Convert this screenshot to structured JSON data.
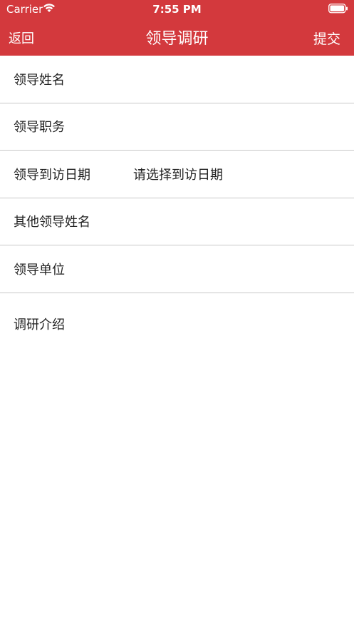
{
  "status_bar": {
    "carrier": "Carrier",
    "time": "7:55 PM",
    "wifi_icon": "wifi-icon",
    "battery_icon": "battery-icon"
  },
  "nav": {
    "back_label": "返回",
    "title": "领导调研",
    "submit_label": "提交",
    "bar_color": "#d3393d"
  },
  "form": {
    "leader_name_label": "领导姓名",
    "leader_position_label": "领导职务",
    "visit_date_label": "领导到访日期",
    "visit_date_placeholder": "请选择到访日期",
    "other_leaders_label": "其他领导姓名",
    "leader_unit_label": "领导单位",
    "research_intro_label": "调研介绍"
  }
}
